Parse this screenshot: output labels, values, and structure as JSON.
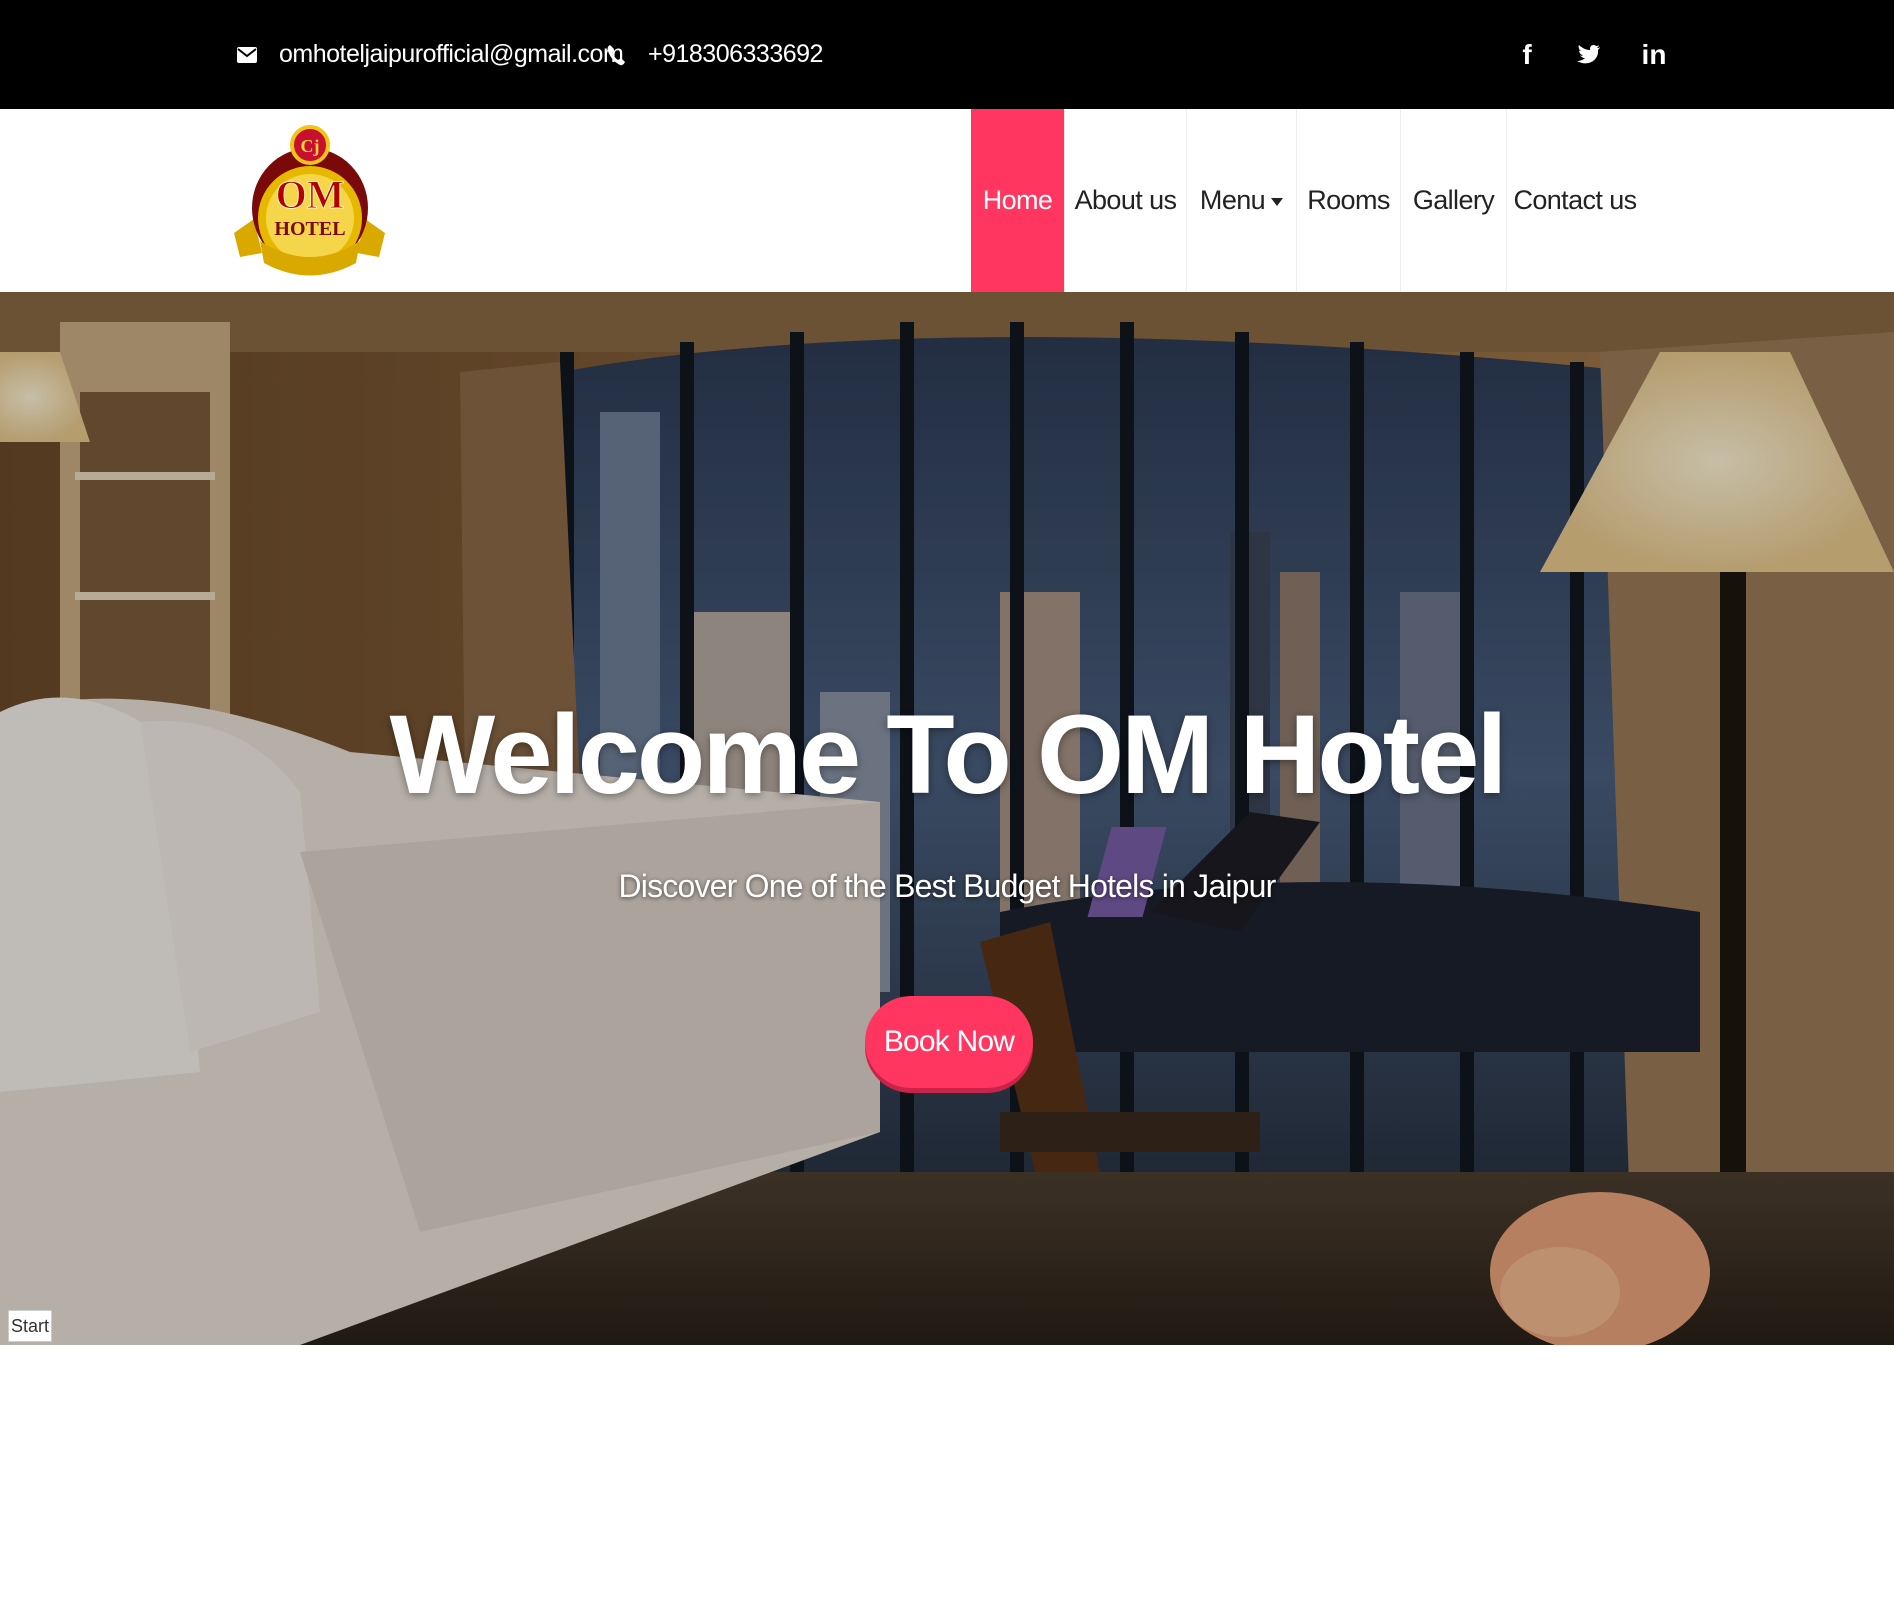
{
  "topbar": {
    "email": "omhoteljaipurofficial@gmail.com",
    "phone": "+918306333692",
    "social": {
      "facebook_glyph": "f",
      "twitter_glyph": "t",
      "linkedin_glyph": "in"
    },
    "icons": [
      "envelope-icon",
      "phone-icon",
      "facebook-icon",
      "twitter-icon",
      "linkedin-icon"
    ]
  },
  "header": {
    "logo": {
      "line1": "OM",
      "line2": "HOTEL"
    },
    "nav": [
      {
        "label": "Home",
        "active": true
      },
      {
        "label": "About us"
      },
      {
        "label": "Menu",
        "has_dropdown": true
      },
      {
        "label": "Rooms"
      },
      {
        "label": "Gallery"
      },
      {
        "label": "Contact us"
      }
    ]
  },
  "hero": {
    "title": "Welcome To OM Hotel",
    "subtitle": "Discover One of the Best Budget Hotels in Jaipur",
    "cta_label": "Book Now"
  },
  "misc": {
    "start_label": "Start"
  },
  "colors": {
    "accent": "#ff3660",
    "topbar_bg": "#000000",
    "text_dark": "#222222"
  }
}
